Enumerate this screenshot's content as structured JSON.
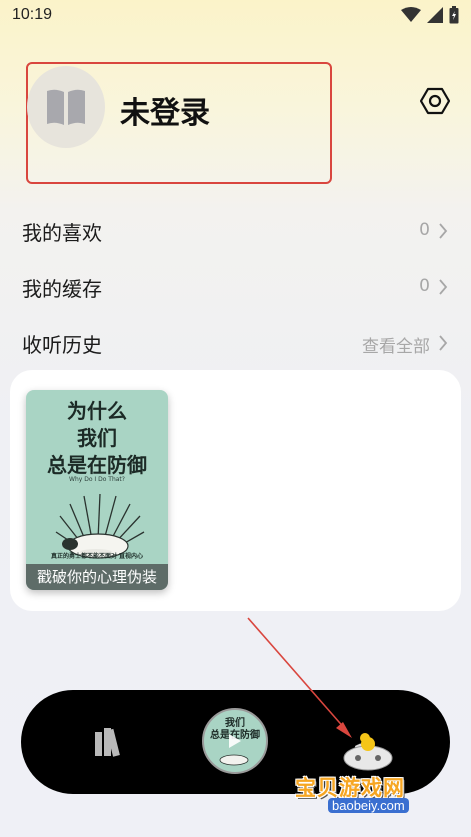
{
  "status_bar": {
    "time": "10:19"
  },
  "profile": {
    "username": "未登录",
    "avatar_icon": "book-icon",
    "settings_icon": "gear-icon"
  },
  "menu": [
    {
      "label": "我的喜欢",
      "value": "0"
    },
    {
      "label": "我的缓存",
      "value": "0"
    },
    {
      "label": "收听历史",
      "value": "查看全部"
    }
  ],
  "history": [
    {
      "title": "为什么\n我们\n总是在防御",
      "subtitle": "Why Do I Do That?",
      "tagline": "真正的勇士都不能不面对\n直视内心",
      "caption": "戳破你的心理伪装"
    }
  ],
  "bottom_nav": {
    "items": [
      {
        "name": "library",
        "icon": "books-icon"
      },
      {
        "name": "now-playing",
        "title": "我们\n总是在防御"
      },
      {
        "name": "mine",
        "icon": "gamepad-icon"
      }
    ]
  },
  "watermark": {
    "text": "宝贝游戏网",
    "url": "baobeiy.com"
  },
  "colors": {
    "annotation_red": "#d9463e",
    "nav_background": "#000000",
    "cover_green": "#a9d4c4"
  }
}
